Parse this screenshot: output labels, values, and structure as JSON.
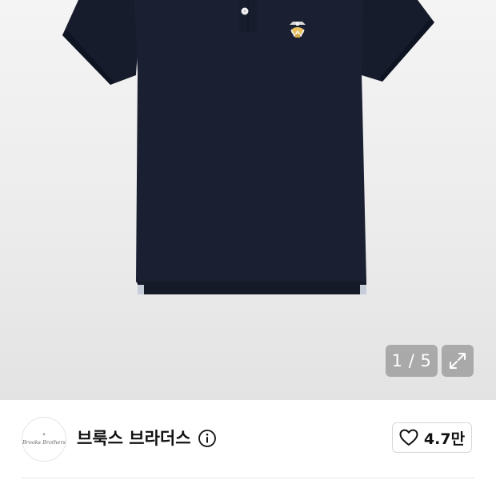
{
  "gallery": {
    "image": "navy polo shirt with embroidered logo",
    "counter": "1 / 5",
    "expand_icon": "expand-arrows-icon"
  },
  "brand": {
    "logo_text": "Brooks Brothers",
    "name": "브룩스 브라더스",
    "info_icon": "info-circle-icon"
  },
  "like": {
    "icon": "heart-outline-icon",
    "count": "4.7만"
  },
  "colors": {
    "shirt": "#161c2c",
    "gallery_bg": "#ececec",
    "text": "#111111",
    "border": "#d7d7d7"
  }
}
